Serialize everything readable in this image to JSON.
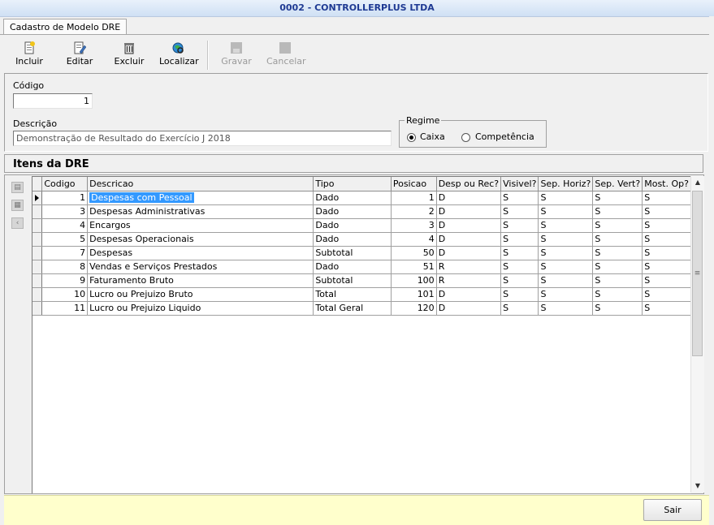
{
  "window": {
    "title": "0002 - CONTROLLERPLUS LTDA"
  },
  "tab": {
    "label": "Cadastro de Modelo DRE"
  },
  "toolbar": {
    "incluir": "Incluir",
    "editar": "Editar",
    "excluir": "Excluir",
    "localizar": "Localizar",
    "gravar": "Gravar",
    "cancelar": "Cancelar"
  },
  "form": {
    "codigo_label": "Código",
    "codigo_value": "1",
    "descricao_label": "Descrição",
    "descricao_value": "Demonstração de Resultado do Exercício J 2018",
    "regime_label": "Regime",
    "regime_options": [
      "Caixa",
      "Competência"
    ],
    "regime_selected": "Caixa"
  },
  "section": {
    "title": "Itens da DRE"
  },
  "grid": {
    "columns": [
      "Codigo",
      "Descricao",
      "Tipo",
      "Posicao",
      "Desp ou Rec?",
      "Visivel?",
      "Sep. Horiz?",
      "Sep. Vert?",
      "Most. Op?"
    ],
    "rows": [
      [
        "1",
        "Despesas com Pessoal",
        "Dado",
        "1",
        "D",
        "S",
        "S",
        "S",
        "S"
      ],
      [
        "3",
        "Despesas Administrativas",
        "Dado",
        "2",
        "D",
        "S",
        "S",
        "S",
        "S"
      ],
      [
        "4",
        "Encargos",
        "Dado",
        "3",
        "D",
        "S",
        "S",
        "S",
        "S"
      ],
      [
        "5",
        "Despesas Operacionais",
        "Dado",
        "4",
        "D",
        "S",
        "S",
        "S",
        "S"
      ],
      [
        "7",
        "Despesas",
        "Subtotal",
        "50",
        "D",
        "S",
        "S",
        "S",
        "S"
      ],
      [
        "8",
        "Vendas e Serviços Prestados",
        "Dado",
        "51",
        "R",
        "S",
        "S",
        "S",
        "S"
      ],
      [
        "9",
        "Faturamento Bruto",
        "Subtotal",
        "100",
        "R",
        "S",
        "S",
        "S",
        "S"
      ],
      [
        "10",
        "Lucro ou Prejuizo Bruto",
        "Total",
        "101",
        "D",
        "S",
        "S",
        "S",
        "S"
      ],
      [
        "11",
        "Lucro ou Prejuizo Liquido",
        "Total Geral",
        "120",
        "D",
        "S",
        "S",
        "S",
        "S"
      ]
    ],
    "selected_row": 0
  },
  "footer": {
    "sair": "Sair"
  }
}
